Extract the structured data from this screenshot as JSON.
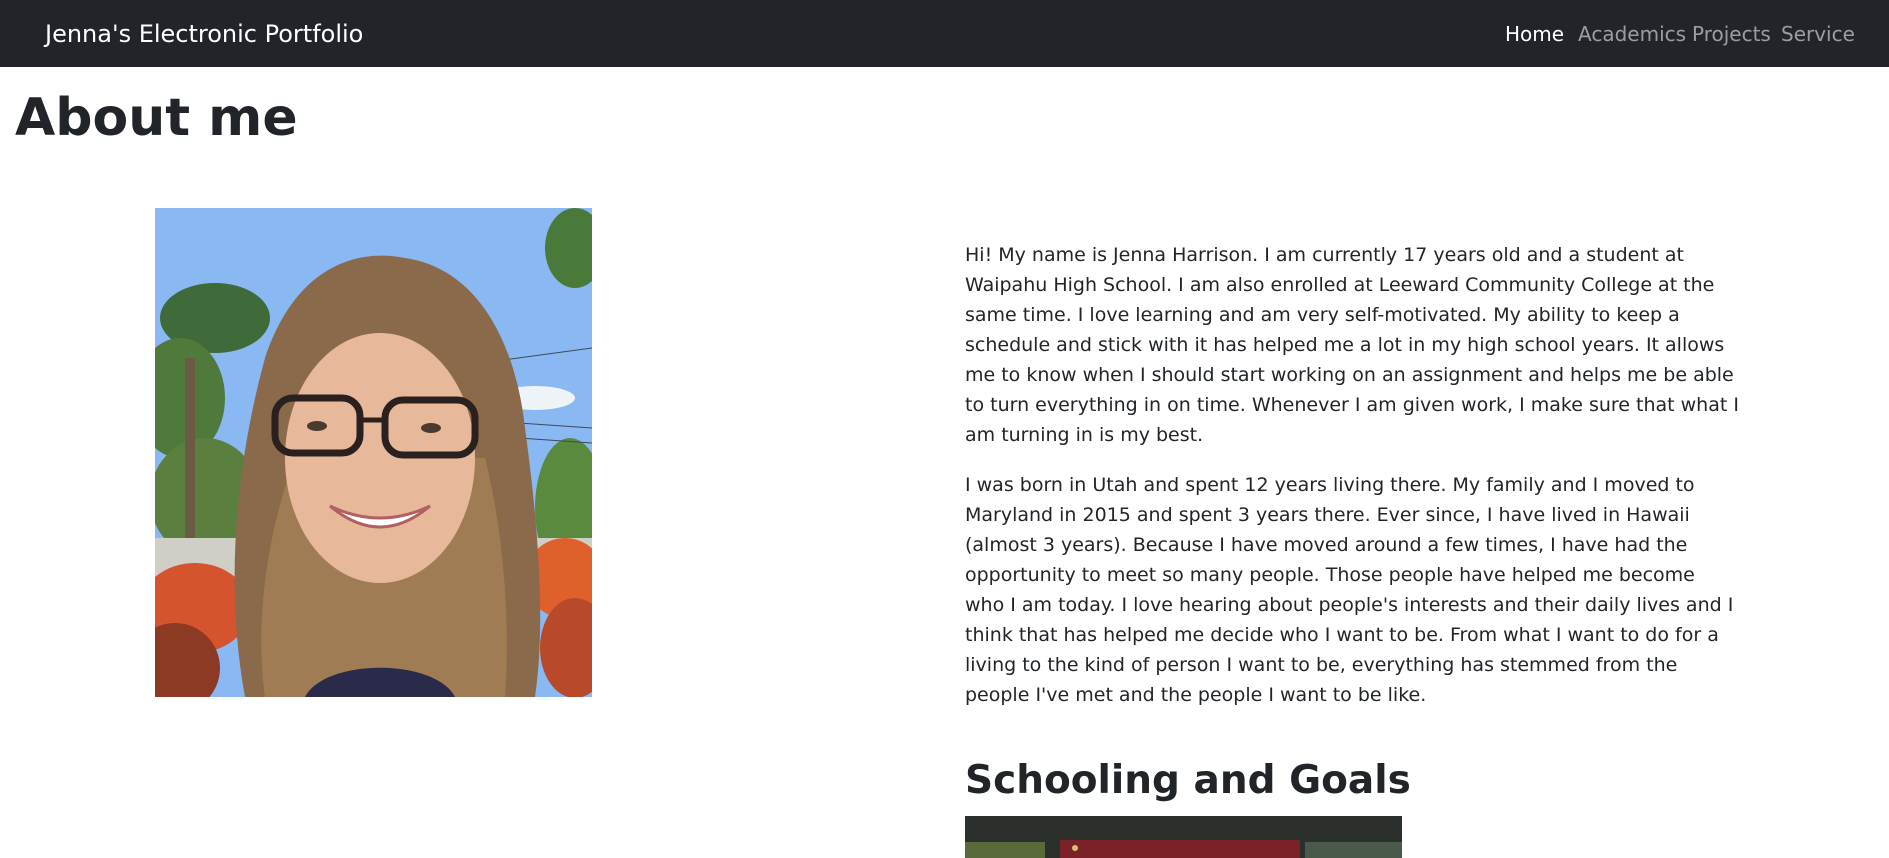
{
  "navbar": {
    "brand": "Jenna's Electronic Portfolio",
    "links": [
      {
        "label": "Home",
        "active": true
      },
      {
        "label": "Academics",
        "active": false
      },
      {
        "label": "Projects",
        "active": false
      },
      {
        "label": "Service",
        "active": false
      }
    ],
    "bg_color": "#212529"
  },
  "main": {
    "title": "About me",
    "bio_paragraphs": [
      "Hi! My name is Jenna Harrison. I am currently 17 years old and a student at Waipahu High School. I am also enrolled at Leeward Community College at the same time. I love learning and am very self-motivated. My ability to keep a schedule and stick with it has helped me a lot in my high school years. It allows me to know when I should start working on an assignment and helps me be able to turn everything in on time. Whenever I am given work, I make sure that what I am turning in is my best.",
      "I was born in Utah and spent 12 years living there. My family and I moved to Maryland in 2015 and spent 3 years there. Ever since, I have lived in Hawaii (almost 3 years). Because I have moved around a few times, I have had the opportunity to meet so many people. Those people have helped me become who I am today. I love hearing about people's interests and their daily lives and I think that has helped me decide who I want to be. From what I want to do for a living to the kind of person I want to be, everything has stemmed from the people I've met and the people I want to be like."
    ],
    "section_title": "Schooling and Goals"
  }
}
